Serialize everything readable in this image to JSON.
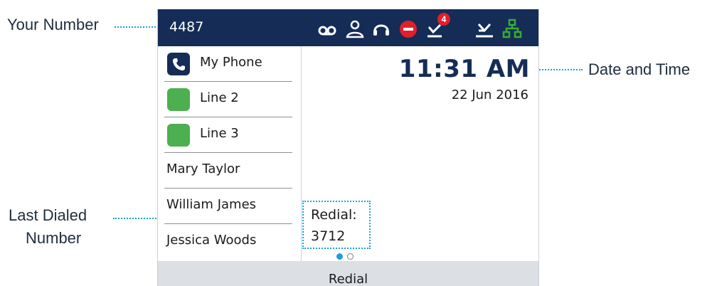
{
  "callouts": {
    "your_number": "Your Number",
    "date_and_time": "Date and Time",
    "last_dialed_line1": "Last Dialed",
    "last_dialed_line2": "Number"
  },
  "status_bar": {
    "extension": "4487",
    "icons": [
      "voicemail-icon",
      "contacts-icon",
      "headset-icon",
      "do-not-disturb-icon",
      "missed-calls-icon",
      "placed-calls-icon",
      "network-icon"
    ],
    "missed_calls_badge": "4",
    "colors": {
      "background": "#152c57",
      "dnd": "#e01f2b",
      "badge": "#e01f2b",
      "network": "#3aaa35"
    }
  },
  "lines": [
    {
      "label": "My Phone",
      "icon": "phone-icon",
      "color": "#152c57"
    },
    {
      "label": "Line 2",
      "icon": "line-status-icon",
      "color": "#4caf50"
    },
    {
      "label": "Line 3",
      "icon": "line-status-icon",
      "color": "#4caf50"
    },
    {
      "label": "Mary Taylor"
    },
    {
      "label": "William James"
    },
    {
      "label": "Jessica Woods"
    }
  ],
  "clock": {
    "time": "11:31 AM",
    "date": "22 Jun 2016"
  },
  "redial": {
    "label": "Redial:",
    "number": "3712"
  },
  "pagination": {
    "current": 1,
    "total": 2
  },
  "softkeys": {
    "redial": "Redial"
  }
}
